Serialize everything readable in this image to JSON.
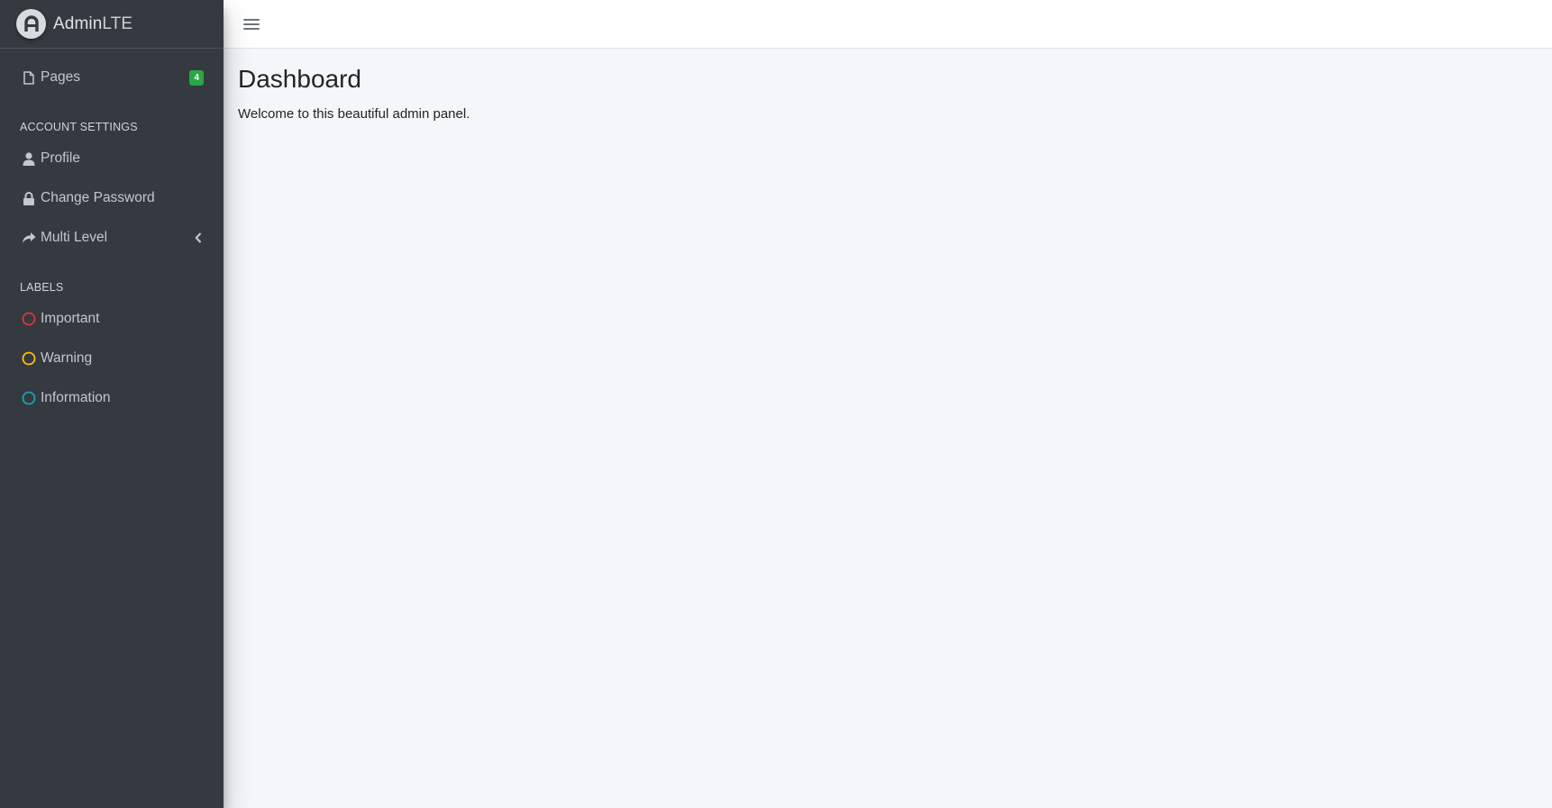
{
  "brand": {
    "name_strong": "Admin",
    "name_light": "LTE"
  },
  "sidebar": {
    "items": [
      {
        "label": "Pages",
        "icon": "file-icon",
        "badge": "4",
        "badge_color": "#28a745"
      },
      {
        "header": "ACCOUNT SETTINGS"
      },
      {
        "label": "Profile",
        "icon": "user-icon"
      },
      {
        "label": "Change Password",
        "icon": "lock-icon"
      },
      {
        "label": "Multi Level",
        "icon": "share-icon",
        "has_children": true
      },
      {
        "header": "LABELS"
      },
      {
        "label": "Important",
        "icon": "circle-icon",
        "color": "#dc3545"
      },
      {
        "label": "Warning",
        "icon": "circle-icon",
        "color": "#ffc107"
      },
      {
        "label": "Information",
        "icon": "circle-icon",
        "color": "#17a2b8"
      }
    ]
  },
  "main": {
    "title": "Dashboard",
    "text": "Welcome to this beautiful admin panel."
  }
}
